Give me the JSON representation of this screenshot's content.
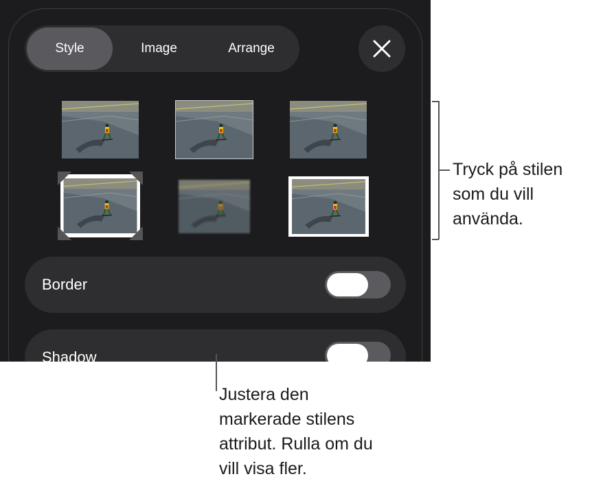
{
  "tabs": [
    {
      "label": "Style",
      "active": true
    },
    {
      "label": "Image",
      "active": false
    },
    {
      "label": "Arrange",
      "active": false
    }
  ],
  "close_icon": "close-icon",
  "styles": [
    {
      "name": "plain"
    },
    {
      "name": "thin-border"
    },
    {
      "name": "reflection"
    },
    {
      "name": "photo-corners"
    },
    {
      "name": "soft-edge"
    },
    {
      "name": "white-frame"
    }
  ],
  "settings": [
    {
      "label": "Border",
      "toggle_on": false
    },
    {
      "label": "Shadow",
      "toggle_on": false
    }
  ],
  "callouts": {
    "styles": "Tryck på stilen\nsom du vill\nanvända.",
    "attributes": "Justera den\nmarkerade stilens\nattribut. Rulla om du\nvill visa fler."
  },
  "colors": {
    "screen_bg": "#1c1c1e",
    "control_bg": "#2e2e31",
    "active_tab": "#5a5a5e",
    "toggle_track": "#5b5b5f"
  }
}
